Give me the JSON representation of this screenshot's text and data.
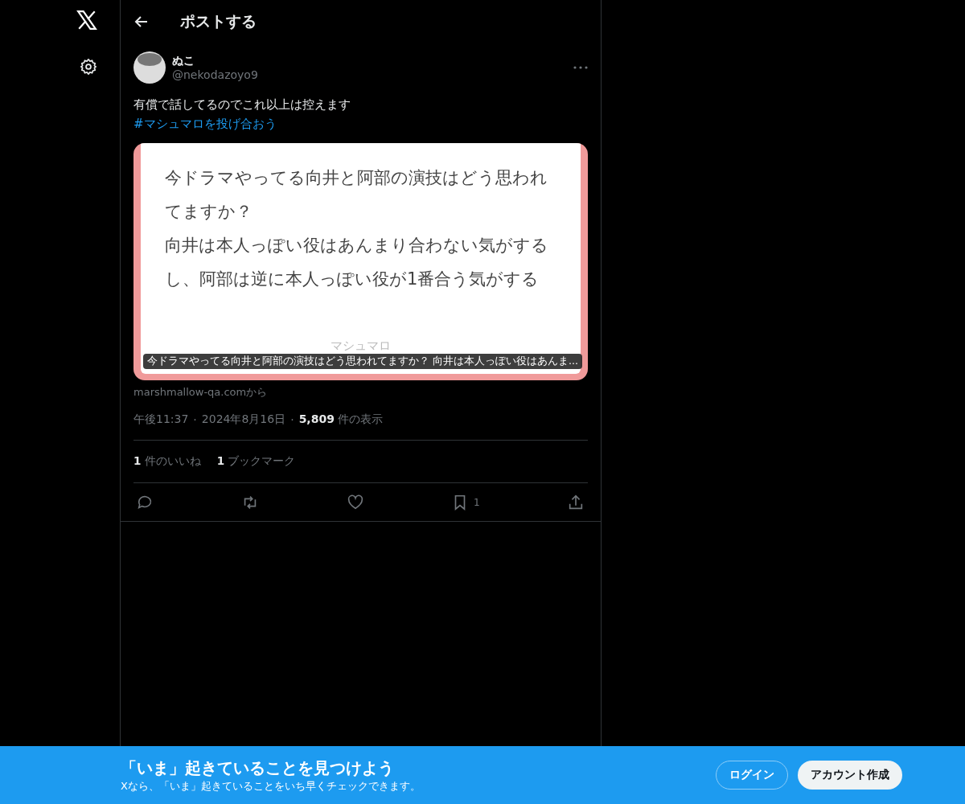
{
  "header": {
    "title": "ポストする"
  },
  "post": {
    "name": "ぬこ",
    "handle": "@nekodazoyo9",
    "text": "有償で話してるのでこれ以上は控えます",
    "hashtag": "#マシュマロを投げ合おう",
    "card": {
      "question": [
        "今ドラマやってる向井と阿部の演技はどう思われてますか？",
        "向井は本人っぽい役はあんまり合わない気がするし、阿部は逆に本人っぽい役が1番合う気がする"
      ],
      "brand": "マシュマロ",
      "caption": "今ドラマやってる向井と阿部の演技はどう思われてますか？ 向井は本人っぽい役はあんま..."
    },
    "source": "marshmallow-qa.comから",
    "time": "午後11:37",
    "separator": "·",
    "date": "2024年8月16日",
    "views_count": "5,809",
    "views_label": "件の表示",
    "stats": [
      {
        "count": "1",
        "label": "件のいいね"
      },
      {
        "count": "1",
        "label": "ブックマーク"
      }
    ],
    "actions": [
      {
        "kind": "reply"
      },
      {
        "kind": "repost"
      },
      {
        "kind": "like"
      },
      {
        "kind": "bookmark",
        "count": "1"
      },
      {
        "kind": "share"
      }
    ]
  },
  "banner": {
    "title": "「いま」起きていることを見つけよう",
    "subtitle": "Xなら、「いま」起きていることをいち早くチェックできます。",
    "login": "ログイン",
    "signup": "アカウント作成"
  }
}
